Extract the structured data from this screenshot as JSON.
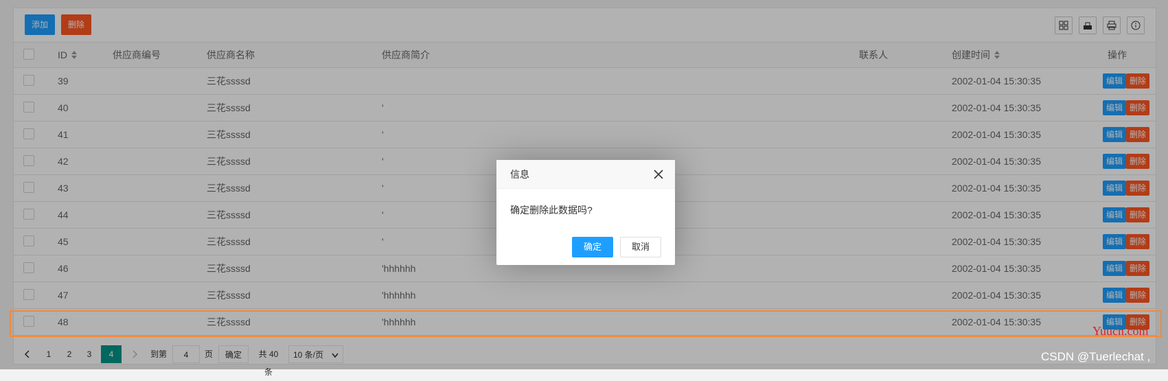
{
  "toolbar": {
    "add_label": "添加",
    "delete_label": "删除",
    "icons": [
      "columns-icon",
      "export-icon",
      "print-icon",
      "info-icon"
    ]
  },
  "table": {
    "headers": {
      "id": "ID",
      "code": "供应商编号",
      "name": "供应商名称",
      "intro": "供应商简介",
      "contact": "联系人",
      "created": "创建时间",
      "actions": "操作"
    },
    "edit_label": "编辑",
    "delete_label": "删除",
    "rows": [
      {
        "id": "39",
        "code": "",
        "name": "三花ssssd",
        "intro": "",
        "contact": "",
        "created": "2002-01-04 15:30:35"
      },
      {
        "id": "40",
        "code": "",
        "name": "三花ssssd",
        "intro": "'",
        "contact": "",
        "created": "2002-01-04 15:30:35"
      },
      {
        "id": "41",
        "code": "",
        "name": "三花ssssd",
        "intro": "'",
        "contact": "",
        "created": "2002-01-04 15:30:35"
      },
      {
        "id": "42",
        "code": "",
        "name": "三花ssssd",
        "intro": "'",
        "contact": "",
        "created": "2002-01-04 15:30:35"
      },
      {
        "id": "43",
        "code": "",
        "name": "三花ssssd",
        "intro": "'",
        "contact": "",
        "created": "2002-01-04 15:30:35"
      },
      {
        "id": "44",
        "code": "",
        "name": "三花ssssd",
        "intro": "'",
        "contact": "",
        "created": "2002-01-04 15:30:35"
      },
      {
        "id": "45",
        "code": "",
        "name": "三花ssssd",
        "intro": "'",
        "contact": "",
        "created": "2002-01-04 15:30:35"
      },
      {
        "id": "46",
        "code": "",
        "name": "三花ssssd",
        "intro": "'hhhhhh",
        "contact": "",
        "created": "2002-01-04 15:30:35"
      },
      {
        "id": "47",
        "code": "",
        "name": "三花ssssd",
        "intro": "'hhhhhh",
        "contact": "",
        "created": "2002-01-04 15:30:35"
      },
      {
        "id": "48",
        "code": "",
        "name": "三花ssssd",
        "intro": "'hhhhhh",
        "contact": "",
        "created": "2002-01-04 15:30:35"
      }
    ]
  },
  "pager": {
    "pages": [
      "1",
      "2",
      "3",
      "4"
    ],
    "current_page": "4",
    "goto_label": "到第",
    "goto_value": "4",
    "page_unit": "页",
    "confirm_label": "确定",
    "total_label": "共 40 条",
    "size_option": "10 条/页"
  },
  "dialog": {
    "title": "信息",
    "message": "确定删除此数据吗?",
    "ok_label": "确定",
    "cancel_label": "取消"
  },
  "watermark": {
    "site": "Yuucn.com",
    "author": "CSDN @Tuerlechat ,"
  },
  "colors": {
    "primary": "#1e9fff",
    "danger": "#ff5722",
    "pager_active": "#009688",
    "highlight": "#f28a3b"
  }
}
